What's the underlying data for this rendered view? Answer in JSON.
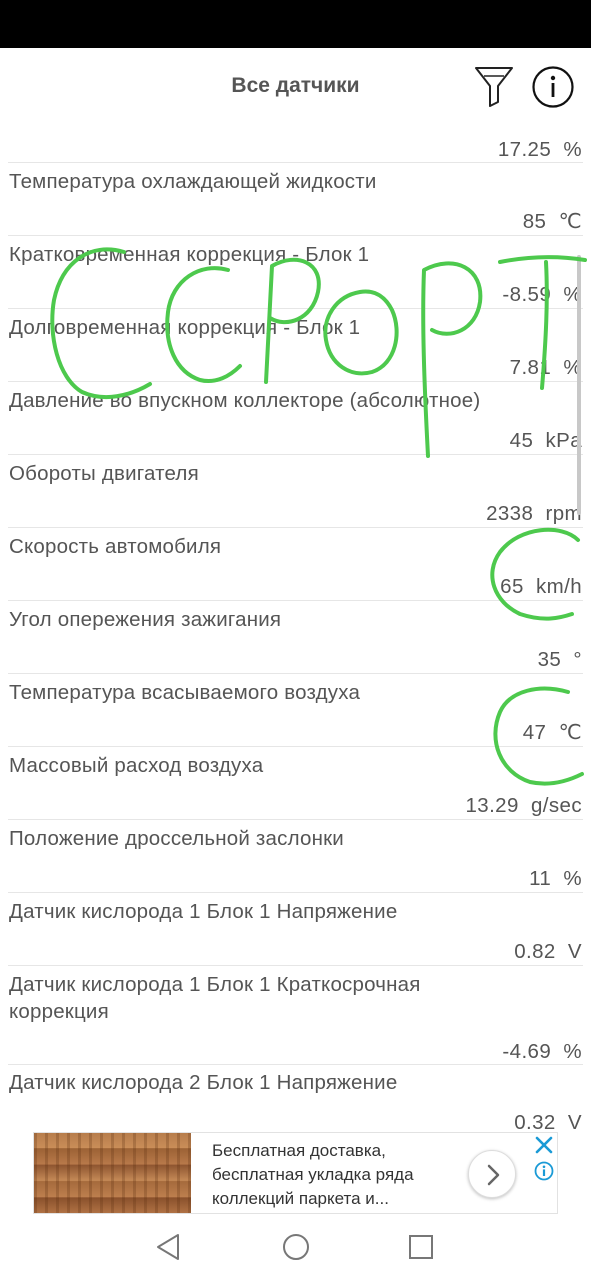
{
  "header": {
    "title": "Все датчики",
    "filter_icon": "filter-funnel-icon",
    "info_icon": "info-circle-icon"
  },
  "sensors": [
    {
      "label": "",
      "value": "17.25",
      "unit": "%"
    },
    {
      "label": "Температура охлаждающей жидкости",
      "value": "85",
      "unit": "℃"
    },
    {
      "label": "Кратковременная коррекция - Блок 1",
      "value": "-8.59",
      "unit": "%"
    },
    {
      "label": "Долговременная коррекция - Блок 1",
      "value": "7.81",
      "unit": "%"
    },
    {
      "label": "Давление во впускном коллекторе (абсолютное)",
      "value": "45",
      "unit": "kPa"
    },
    {
      "label": "Обороты двигателя",
      "value": "2338",
      "unit": "rpm"
    },
    {
      "label": "Скорость автомобиля",
      "value": "65",
      "unit": "km/h"
    },
    {
      "label": "Угол опережения зажигания",
      "value": "35",
      "unit": "°"
    },
    {
      "label": "Температура всасываемого воздуха",
      "value": "47",
      "unit": "℃"
    },
    {
      "label": "Массовый расход воздуха",
      "value": "13.29",
      "unit": "g/sec"
    },
    {
      "label": "Положение дроссельной заслонки",
      "value": "11",
      "unit": "%"
    },
    {
      "label": "Датчик кислорода 1 Блок 1 Напряжение",
      "value": "0.82",
      "unit": "V"
    },
    {
      "label": "Датчик кислорода 1 Блок 1 Краткосрочная коррекция",
      "value": "-4.69",
      "unit": "%"
    },
    {
      "label": "Датчик кислорода 2 Блок 1 Напряжение",
      "value": "0.32",
      "unit": "V"
    }
  ],
  "ad": {
    "text": "Бесплатная доставка, бесплатная укладка ряда коллекций паркета и...",
    "arrow_icon": "chevron-right-icon",
    "close_icon": "close-x-icon",
    "adchoices_icon": "ad-info-icon",
    "accent_color": "#1a9ad6"
  },
  "annotation": {
    "text": "спорт",
    "color": "#4dc94d"
  },
  "nav": {
    "back_icon": "nav-back-icon",
    "home_icon": "nav-home-icon",
    "recent_icon": "nav-recent-apps-icon"
  }
}
